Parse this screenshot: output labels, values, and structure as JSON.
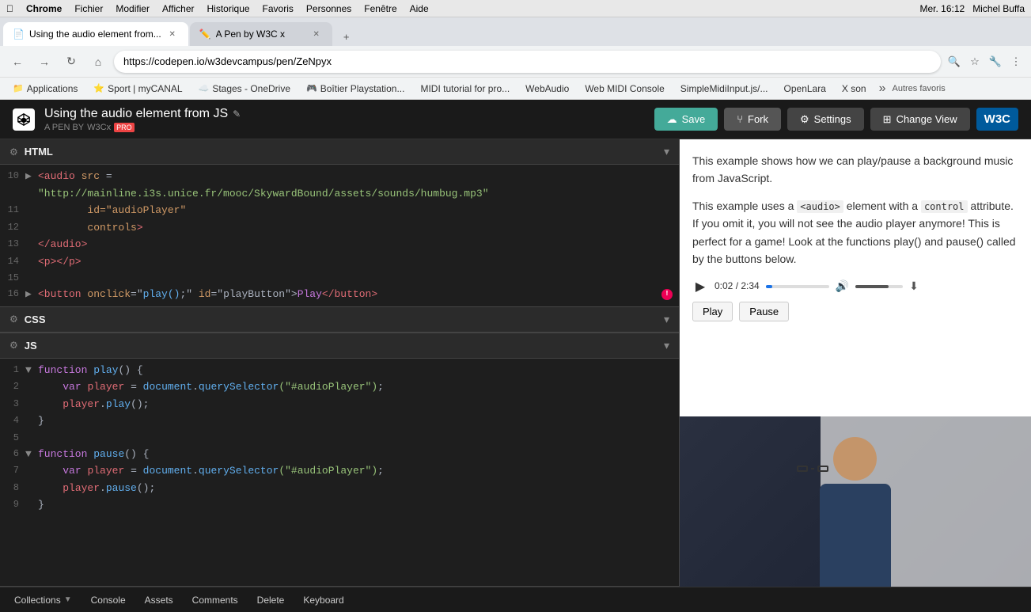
{
  "macos": {
    "apple": "&#63743;",
    "browser": "Chrome",
    "menu_items": [
      "Fichier",
      "Modifier",
      "Afficher",
      "Historique",
      "Favoris",
      "Personnes",
      "Fenêtre",
      "Aide"
    ],
    "right_info": "Mer. 16:12",
    "user": "Michel Buffa"
  },
  "tabs": [
    {
      "id": "active",
      "title": "Using the audio element from...",
      "favicon": "📄"
    },
    {
      "id": "inactive",
      "title": "A Pen by W3C x",
      "favicon": "✏️"
    }
  ],
  "addressbar": {
    "url": "https://codepen.io/w3devcampus/pen/ZeNpyx",
    "back_enabled": false,
    "forward_enabled": false
  },
  "bookmarks": [
    {
      "label": "Applications"
    },
    {
      "label": "Sport | myCANAL"
    },
    {
      "label": "Stages - OneDrive"
    },
    {
      "label": "Boîtier Playstation..."
    },
    {
      "label": "MIDI tutorial for pro..."
    },
    {
      "label": "WebAudio"
    },
    {
      "label": "Web MIDI Console"
    },
    {
      "label": "SimpleMidiInput.js/..."
    },
    {
      "label": "OpenLara"
    },
    {
      "label": "X son"
    }
  ],
  "codepen": {
    "pen_title": "Using the audio element from JS",
    "pen_author_label": "A PEN BY",
    "pen_author": "W3Cx",
    "pen_author_badge": "PRO",
    "save_label": "Save",
    "fork_label": "Fork",
    "settings_label": "Settings",
    "changeview_label": "Change View",
    "w3c_label": "W3C"
  },
  "html_panel": {
    "label": "HTML",
    "lines": [
      {
        "num": "10",
        "arrow": "▶",
        "content": [
          {
            "type": "tag",
            "text": "<audio"
          },
          {
            "type": "space",
            "text": " "
          },
          {
            "type": "attr",
            "text": "src"
          },
          {
            "type": "punct",
            "text": " = "
          }
        ]
      },
      {
        "num": "",
        "arrow": "",
        "content": [
          {
            "type": "str",
            "text": "\"http://mainline.i3s.unice.fr/mooc/SkywardBound/assets/sounds/humbug.mp3\""
          }
        ]
      },
      {
        "num": "11",
        "arrow": "",
        "content": [
          {
            "type": "space",
            "text": "            "
          },
          {
            "type": "attr",
            "text": "id=\"audioPlayer\""
          }
        ]
      },
      {
        "num": "12",
        "arrow": "",
        "content": [
          {
            "type": "space",
            "text": "            "
          },
          {
            "type": "attr",
            "text": "controls"
          },
          {
            "type": "tag",
            "text": ">"
          }
        ]
      },
      {
        "num": "13",
        "arrow": "",
        "content": [
          {
            "type": "tag",
            "text": "</audio>"
          }
        ]
      },
      {
        "num": "14",
        "arrow": "",
        "content": [
          {
            "type": "tag",
            "text": "<p></p>"
          }
        ]
      },
      {
        "num": "15",
        "arrow": "",
        "content": []
      },
      {
        "num": "16",
        "arrow": "▶",
        "content": [
          {
            "type": "tag",
            "text": "<button"
          },
          {
            "type": "space",
            "text": " "
          },
          {
            "type": "attr",
            "text": "onclick"
          },
          {
            "type": "punct",
            "text": "=\""
          },
          {
            "type": "fn",
            "text": "play()"
          },
          {
            "type": "punct",
            "text": ";"
          },
          {
            "type": "punct",
            "text": "\" "
          },
          {
            "type": "attr",
            "text": "id"
          },
          {
            "type": "punct",
            "text": "=\"playButton\">"
          },
          {
            "type": "kw",
            "text": "Play"
          },
          {
            "type": "tag",
            "text": "</button>"
          }
        ]
      }
    ]
  },
  "css_panel": {
    "label": "CSS"
  },
  "js_panel": {
    "label": "JS",
    "lines": [
      {
        "num": "1",
        "arrow": "▼",
        "content": [
          {
            "type": "kw",
            "text": "function"
          },
          {
            "type": "space",
            "text": " "
          },
          {
            "type": "fn",
            "text": "play"
          },
          {
            "type": "punct",
            "text": "() {"
          }
        ]
      },
      {
        "num": "2",
        "arrow": "",
        "content": [
          {
            "type": "space",
            "text": "    "
          },
          {
            "type": "kw",
            "text": "var"
          },
          {
            "type": "space",
            "text": " "
          },
          {
            "type": "var",
            "text": "player"
          },
          {
            "type": "punct",
            "text": " = "
          },
          {
            "type": "fn",
            "text": "document"
          },
          {
            "type": "punct",
            "text": "."
          },
          {
            "type": "method",
            "text": "querySelector"
          },
          {
            "type": "str",
            "text": "(\"#audioPlayer\")"
          },
          {
            "type": "punct",
            "text": ";"
          }
        ]
      },
      {
        "num": "3",
        "arrow": "",
        "content": [
          {
            "type": "space",
            "text": "    "
          },
          {
            "type": "var",
            "text": "player"
          },
          {
            "type": "punct",
            "text": "."
          },
          {
            "type": "method",
            "text": "play"
          },
          {
            "type": "punct",
            "text": "();"
          }
        ]
      },
      {
        "num": "4",
        "arrow": "",
        "content": [
          {
            "type": "punct",
            "text": "}"
          }
        ]
      },
      {
        "num": "5",
        "arrow": "",
        "content": []
      },
      {
        "num": "6",
        "arrow": "▼",
        "content": [
          {
            "type": "kw",
            "text": "function"
          },
          {
            "type": "space",
            "text": " "
          },
          {
            "type": "fn",
            "text": "pause"
          },
          {
            "type": "punct",
            "text": "() {"
          }
        ]
      },
      {
        "num": "7",
        "arrow": "",
        "content": [
          {
            "type": "space",
            "text": "    "
          },
          {
            "type": "kw",
            "text": "var"
          },
          {
            "type": "space",
            "text": " "
          },
          {
            "type": "var",
            "text": "player"
          },
          {
            "type": "punct",
            "text": " = "
          },
          {
            "type": "fn",
            "text": "document"
          },
          {
            "type": "punct",
            "text": "."
          },
          {
            "type": "method",
            "text": "querySelector"
          },
          {
            "type": "str",
            "text": "(\"#audioPlayer\")"
          },
          {
            "type": "punct",
            "text": ";"
          }
        ]
      },
      {
        "num": "8",
        "arrow": "",
        "content": [
          {
            "type": "space",
            "text": "    "
          },
          {
            "type": "var",
            "text": "player"
          },
          {
            "type": "punct",
            "text": "."
          },
          {
            "type": "method",
            "text": "pause"
          },
          {
            "type": "punct",
            "text": "();"
          }
        ]
      },
      {
        "num": "9",
        "arrow": "",
        "content": [
          {
            "type": "punct",
            "text": "}"
          }
        ]
      }
    ]
  },
  "preview": {
    "text1": "This example shows how we can play/pause a background music from JavaScript.",
    "text2_prefix": "This example uses a ",
    "text2_code1": "<audio>",
    "text2_middle": " element with a ",
    "text2_code2": "control",
    "text2_suffix": " attribute. If you omit it, you will not see the audio player anymore! This is perfect for a game! Look at the functions play() and pause() called by the buttons below.",
    "audio_time": "0:02 / 2:34",
    "play_button": "Play",
    "pause_button": "Pause"
  },
  "bottom_bar": {
    "collections_label": "Collections",
    "console_label": "Console",
    "assets_label": "Assets",
    "comments_label": "Comments",
    "delete_label": "Delete",
    "keyboard_label": "Keyboard"
  }
}
